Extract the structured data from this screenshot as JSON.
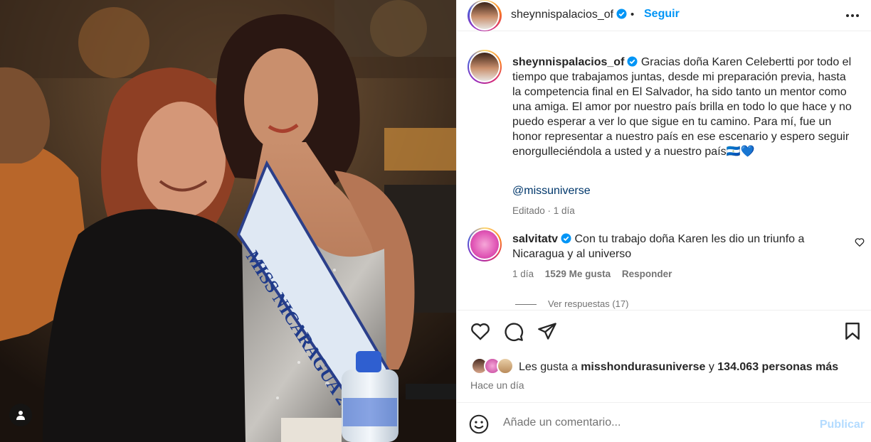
{
  "post": {
    "username": "sheynnispalacios_of",
    "follow_label": "Seguir",
    "separator": "•"
  },
  "photo": {
    "sash_text": "MISS NICARAGUA 20"
  },
  "caption": {
    "username": "sheynnispalacios_of",
    "text": "Gracias doña Karen Celebertti por todo el tiempo que trabajamos juntas, desde mi preparación previa, hasta la competencia final en El Salvador, ha sido tanto un mentor como una amiga. El amor por nuestro país brilla en todo lo que hace y no puedo esperar a ver lo que sigue en tu camino. Para mí, fue un honor representar a nuestro país en ese escenario y espero seguir enorgulleciéndola a usted y a nuestro país🇳🇮💙",
    "mention": "@missuniverse",
    "edited": "Editado · 1 día"
  },
  "comment": {
    "username": "salvitatv",
    "text": "Con tu trabajo doña Karen les dio un triunfo a Nicaragua y al universo",
    "time": "1 día",
    "likes": "1529 Me gusta",
    "reply_label": "Responder",
    "view_replies": "Ver respuestas (17)"
  },
  "likes": {
    "prefix": "Les gusta a",
    "user": "misshondurasuniverse",
    "middle": "y",
    "count": "134.063 personas más"
  },
  "date": "Hace un día",
  "composer": {
    "placeholder": "Añade un comentario...",
    "publish_label": "Publicar"
  },
  "colors": {
    "accent": "#0095f6",
    "link": "#00376b",
    "muted": "#737373",
    "publish_disabled": "#b3dbff",
    "sash": "#dfe8f3",
    "verified": "#0095f6"
  },
  "icons": [
    "more-options-icon",
    "verified-badge-icon",
    "heart-icon",
    "comment-icon",
    "share-icon",
    "bookmark-icon",
    "emoji-icon",
    "user-tag-icon"
  ]
}
